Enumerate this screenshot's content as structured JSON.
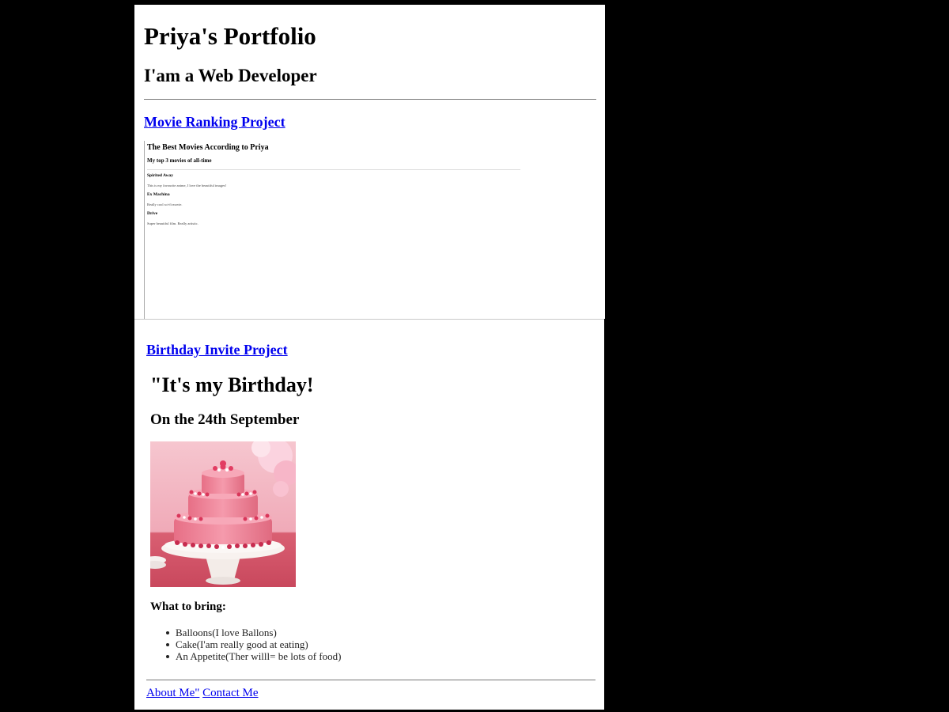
{
  "portfolio": {
    "title": "Priya's Portfolio",
    "subtitle": "I'am a Web Developer"
  },
  "movie_project": {
    "link_label": "Movie Ranking Project",
    "preview": {
      "title": "The Best Movies According to Priya",
      "subtitle": "My top 3 movies of all-time",
      "movies": [
        {
          "name": "Spirited Away",
          "desc": "This is my favourite anime, I love the beautiful images!"
        },
        {
          "name": "Ex Machina",
          "desc": "Really cool sci-fi movie."
        },
        {
          "name": "Drive",
          "desc": "Super beautiful film. Really artistic."
        }
      ]
    }
  },
  "birthday_project": {
    "link_label": "Birthday Invite Project",
    "heading": "\"It's my Birthday!",
    "date_line": "On the 24th September",
    "what_to_bring_heading": "What to bring:",
    "items": [
      "Balloons(I love Ballons)",
      "Cake(I'am really good at eating)",
      "An Appetite(Ther willl= be lots of food)"
    ]
  },
  "footer": {
    "about_label": "About Me\"",
    "contact_label": "Contact Me"
  },
  "colors": {
    "link": "#0000ee",
    "background": "#000000",
    "page": "#ffffff"
  }
}
